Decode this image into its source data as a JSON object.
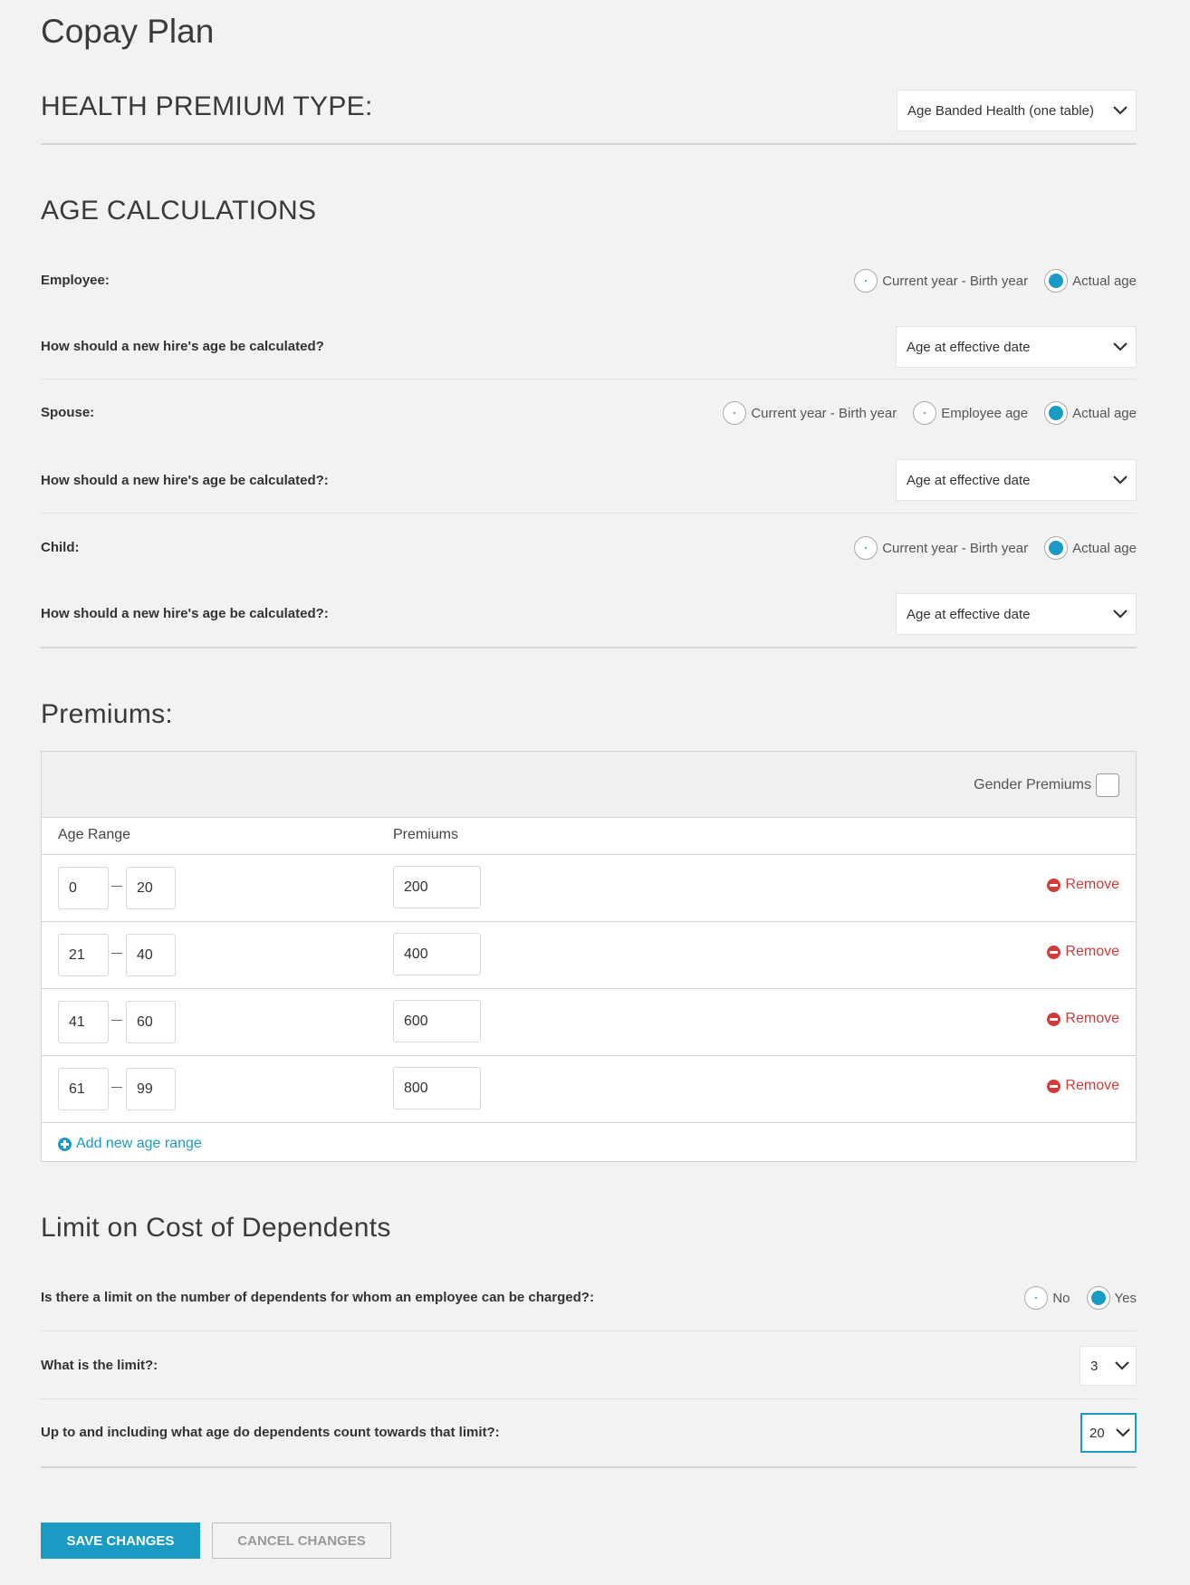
{
  "page_title": "Copay Plan",
  "health_premium": {
    "heading": "HEALTH PREMIUM TYPE:",
    "selected": "Age Banded Health (one table)"
  },
  "age_calc": {
    "heading": "AGE CALCULATIONS",
    "employee": {
      "label": "Employee:",
      "options": [
        "Current year - Birth year",
        "Actual age"
      ],
      "selected": "Actual age",
      "hire_label": "How should a new hire's age be calculated?",
      "hire_value": "Age at effective date"
    },
    "spouse": {
      "label": "Spouse:",
      "options": [
        "Current year - Birth year",
        "Employee age",
        "Actual age"
      ],
      "selected": "Actual age",
      "hire_label": "How should a new hire's age be calculated?:",
      "hire_value": "Age at effective date"
    },
    "child": {
      "label": "Child:",
      "options": [
        "Current year - Birth year",
        "Actual age"
      ],
      "selected": "Actual age",
      "hire_label": "How should a new hire's age be calculated?:",
      "hire_value": "Age at effective date"
    }
  },
  "premiums": {
    "heading": "Premiums:",
    "gender_label": "Gender Premiums",
    "gender_checked": false,
    "col_age_range": "Age Range",
    "col_premiums": "Premiums",
    "remove_label": "Remove",
    "add_label": "Add new age range",
    "rows": [
      {
        "from": "0",
        "to": "20",
        "premium": "200"
      },
      {
        "from": "21",
        "to": "40",
        "premium": "400"
      },
      {
        "from": "41",
        "to": "60",
        "premium": "600"
      },
      {
        "from": "61",
        "to": "99",
        "premium": "800"
      }
    ]
  },
  "limit": {
    "heading": "Limit on Cost of Dependents",
    "q1": "Is there a limit on the number of dependents for whom an employee can be charged?:",
    "q1_options": [
      "No",
      "Yes"
    ],
    "q1_selected": "Yes",
    "q2": "What is the limit?:",
    "q2_value": "3",
    "q3": "Up to and including what age do dependents count towards that limit?:",
    "q3_value": "20"
  },
  "buttons": {
    "save": "SAVE CHANGES",
    "cancel": "CANCEL CHANGES"
  },
  "colors": {
    "accent": "#1a9bc4",
    "danger": "#d33a3a",
    "background": "#f2f2f2"
  }
}
